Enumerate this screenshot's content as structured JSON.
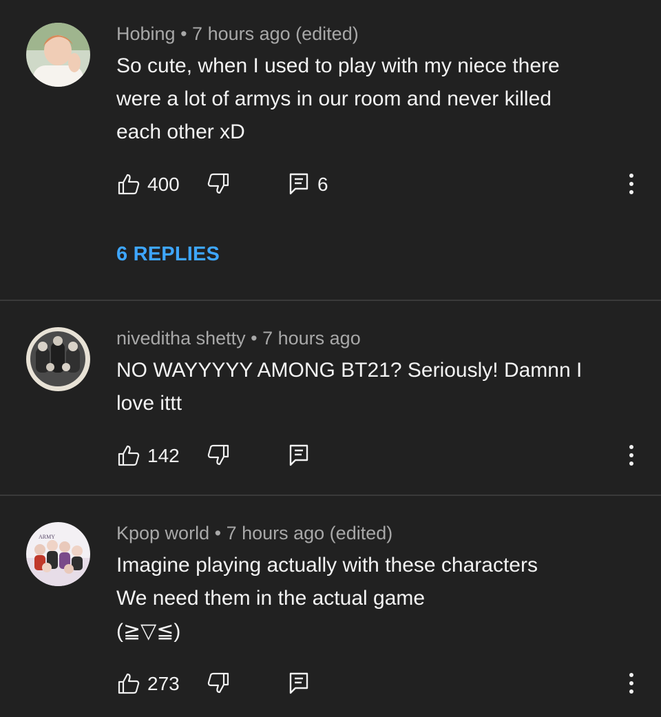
{
  "comments": [
    {
      "author": "Hobing",
      "separator": "•",
      "time": "7 hours ago (edited)",
      "lines": [
        "So cute, when I used to play with my niece there",
        "were a lot of armys in our room and never killed",
        "each other xD"
      ],
      "likes": "400",
      "reply_count": "6",
      "replies_link": "6 REPLIES"
    },
    {
      "author": "niveditha shetty",
      "separator": "•",
      "time": "7 hours ago",
      "lines": [
        "NO WAYYYYY AMONG BT21? Seriously! Damnn I",
        "love ittt"
      ],
      "likes": "142"
    },
    {
      "author": "Kpop world",
      "separator": "•",
      "time": "7 hours ago (edited)",
      "lines": [
        "Imagine playing actually with these characters",
        "We need them in the actual game",
        "(≧▽≦)"
      ],
      "likes": "273",
      "avatar_text": "ARMY"
    }
  ],
  "icons": {
    "like": "thumb-up-icon",
    "dislike": "thumb-down-icon",
    "reply": "reply-icon",
    "more": "more-vertical-icon"
  },
  "colors": {
    "background": "#212121",
    "link": "#3ea6ff",
    "meta": "#a8a8a8",
    "divider": "#3a3a3a"
  }
}
